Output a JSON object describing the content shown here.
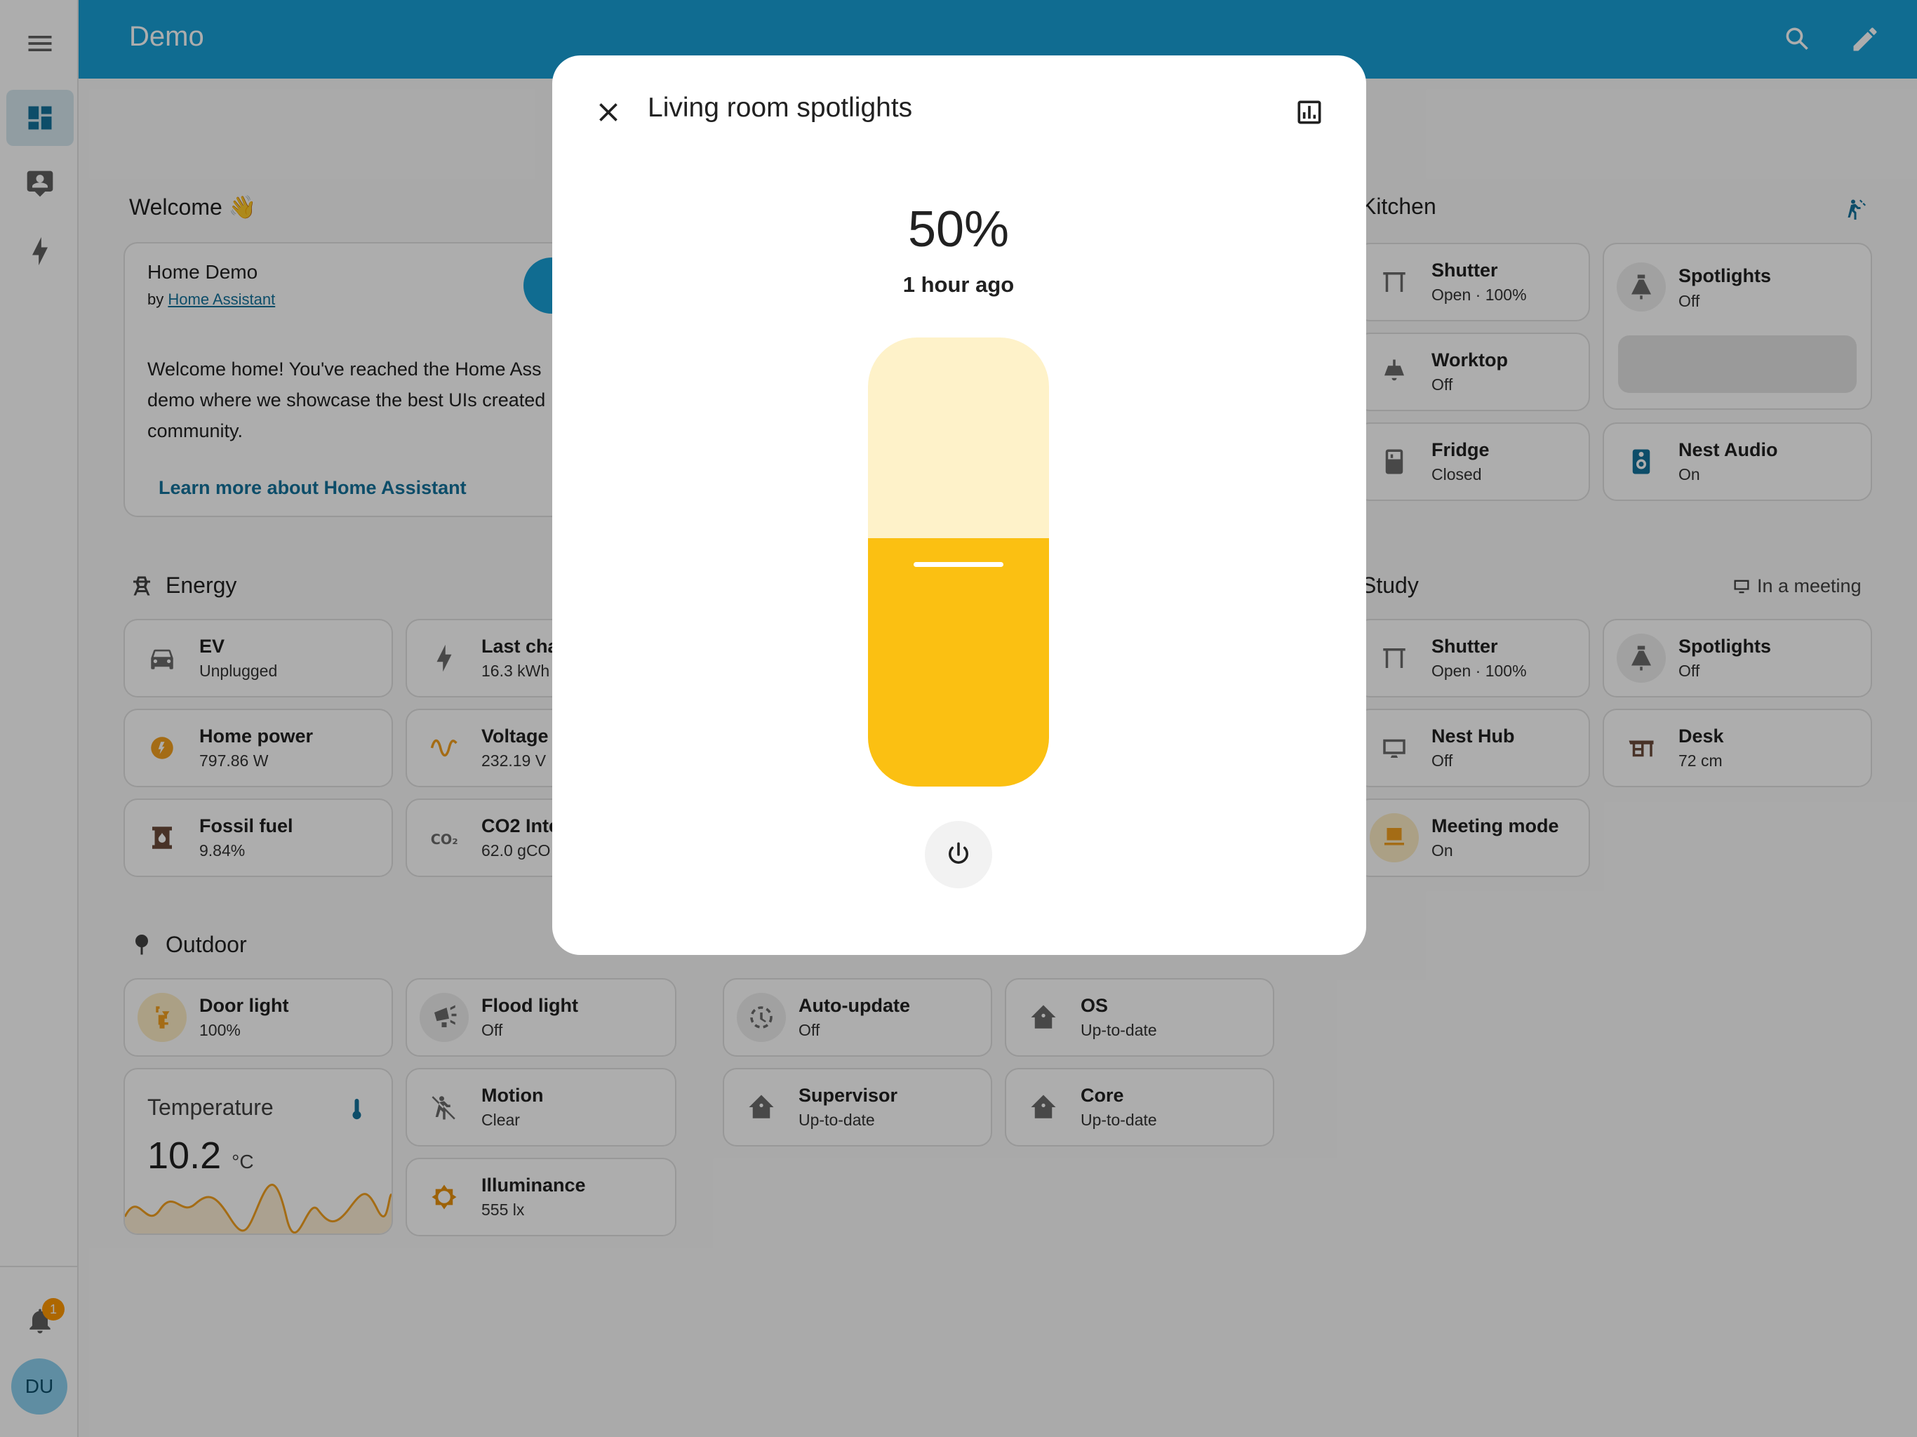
{
  "app": {
    "title": "Demo"
  },
  "sidebar": {
    "items": [
      {
        "icon": "dashboard-icon",
        "active": true
      },
      {
        "icon": "map-account-icon",
        "active": false
      },
      {
        "icon": "energy-icon",
        "active": false
      }
    ],
    "notification_count": "1",
    "user_initials": "DU"
  },
  "welcome": {
    "section_title": "Welcome 👋",
    "card_title": "Home Demo",
    "by_prefix": "by",
    "by_link": "Home Assistant",
    "body_line1": "Welcome home! You've reached the Home Ass",
    "body_line2": "demo where we showcase the best UIs created",
    "body_line3": "community.",
    "learn_more": "Learn more about Home Assistant"
  },
  "energy": {
    "section_title": "Energy",
    "tiles": [
      {
        "name": "EV",
        "state": "Unplugged"
      },
      {
        "name": "Last cha",
        "state": "16.3 kWh"
      },
      {
        "name": "Home power",
        "state": "797.86 W"
      },
      {
        "name": "Voltage",
        "state": "232.19 V"
      },
      {
        "name": "Fossil fuel",
        "state": "9.84%"
      },
      {
        "name": "CO2 Inte",
        "state": "62.0 gCO"
      }
    ]
  },
  "outdoor": {
    "section_title": "Outdoor",
    "tiles": [
      {
        "name": "Door light",
        "state": "100%"
      },
      {
        "name": "Flood light",
        "state": "Off"
      },
      {
        "name": "Motion",
        "state": "Clear"
      },
      {
        "name": "Illuminance",
        "state": "555 lx"
      }
    ],
    "temperature": {
      "label": "Temperature",
      "value": "10.2",
      "unit": "°C"
    }
  },
  "updates": {
    "tiles": [
      {
        "name": "Auto-update",
        "state": "Off"
      },
      {
        "name": "OS",
        "state": "Up-to-date"
      },
      {
        "name": "Supervisor",
        "state": "Up-to-date"
      },
      {
        "name": "Core",
        "state": "Up-to-date"
      }
    ]
  },
  "kitchen": {
    "section_title": "Kitchen",
    "tiles": [
      {
        "name": "Shutter",
        "state": "Open · 100%"
      },
      {
        "name": "Spotlights",
        "state": "Off"
      },
      {
        "name": "Worktop",
        "state": "Off"
      },
      {
        "name": "Fridge",
        "state": "Closed"
      },
      {
        "name": "Nest Audio",
        "state": "On"
      }
    ]
  },
  "study": {
    "section_title": "Study",
    "badge": "In a meeting",
    "tiles": [
      {
        "name": "Shutter",
        "state": "Open · 100%"
      },
      {
        "name": "Spotlights",
        "state": "Off"
      },
      {
        "name": "Nest Hub",
        "state": "Off"
      },
      {
        "name": "Desk",
        "state": "72 cm"
      },
      {
        "name": "Meeting mode",
        "state": "On"
      }
    ]
  },
  "dialog": {
    "title": "Living room spotlights",
    "brightness": "50%",
    "brightness_fraction": 0.5,
    "last_changed": "1 hour ago"
  },
  "colors": {
    "primary": "#18a0d6",
    "accent_amber": "#fbc012",
    "amber_light": "#fef2c9",
    "orange_icon": "#f2a01f"
  }
}
